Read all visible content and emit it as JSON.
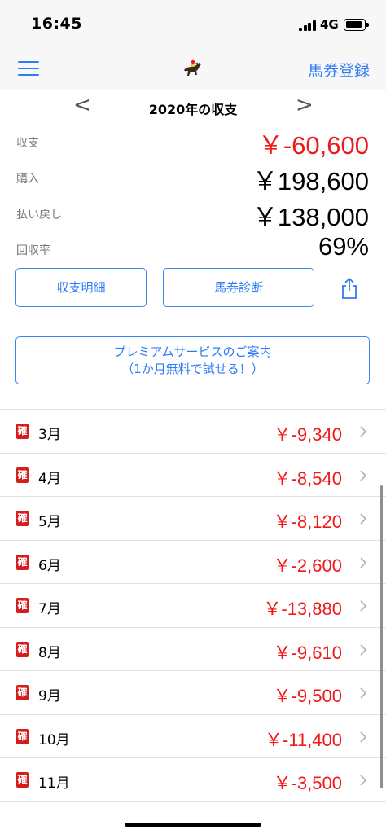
{
  "status_bar": {
    "time": "16:45",
    "network": "4G"
  },
  "nav": {
    "action_label": "馬券登録"
  },
  "year_nav": {
    "prev": "<",
    "title": "2020年の収支",
    "next": ">"
  },
  "summary": {
    "balance_label": "収支",
    "balance_value": "￥-60,600",
    "purchase_label": "購入",
    "purchase_value": "￥198,600",
    "payout_label": "払い戻し",
    "payout_value": "￥138,000",
    "recovery_label": "回収率",
    "recovery_value": "69%"
  },
  "buttons": {
    "detail": "収支明細",
    "diagnosis": "馬券診断",
    "premium_line1": "プレミアムサービスのご案内",
    "premium_line2": "（1か月無料で試せる！）"
  },
  "months": [
    {
      "badge": "確",
      "label": "3月",
      "amount": "￥-9,340"
    },
    {
      "badge": "確",
      "label": "4月",
      "amount": "￥-8,540"
    },
    {
      "badge": "確",
      "label": "5月",
      "amount": "￥-8,120"
    },
    {
      "badge": "確",
      "label": "6月",
      "amount": "￥-2,600"
    },
    {
      "badge": "確",
      "label": "7月",
      "amount": "￥-13,880"
    },
    {
      "badge": "確",
      "label": "8月",
      "amount": "￥-9,610"
    },
    {
      "badge": "確",
      "label": "9月",
      "amount": "￥-9,500"
    },
    {
      "badge": "確",
      "label": "10月",
      "amount": "￥-11,400"
    },
    {
      "badge": "確",
      "label": "11月",
      "amount": "￥-3,500"
    }
  ],
  "colors": {
    "accent": "#2f7cf6",
    "negative": "#f01818",
    "badge": "#d61c1c"
  },
  "icons": [
    "menu-icon",
    "horse-jockey-icon",
    "share-icon",
    "chevron-right-icon",
    "signal-icon",
    "battery-icon"
  ]
}
